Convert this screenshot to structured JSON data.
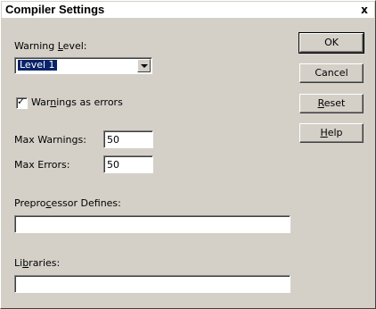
{
  "window": {
    "title": "Compiler Settings",
    "close_glyph": "x"
  },
  "warning_level": {
    "label_pre": "Warning ",
    "label_accel": "L",
    "label_post": "evel:",
    "selected": "Level 1"
  },
  "warnings_as_errors": {
    "checked": true,
    "check_glyph": "✓",
    "label_pre": "War",
    "label_accel": "n",
    "label_post": "ings as errors"
  },
  "max_warnings": {
    "label": "Max Warnings:",
    "value": "50"
  },
  "max_errors": {
    "label": "Max Errors:",
    "value": "50"
  },
  "preprocessor_defines": {
    "label_pre": "Prepro",
    "label_accel": "c",
    "label_post": "essor Defines:",
    "value": ""
  },
  "libraries": {
    "label_pre": "Li",
    "label_accel": "b",
    "label_post": "raries:",
    "value": ""
  },
  "buttons": {
    "ok": "OK",
    "cancel": "Cancel",
    "reset_accel": "R",
    "reset_rest": "eset",
    "help_accel": "H",
    "help_rest": "elp"
  },
  "colors": {
    "dialog_face": "#d4d0c8",
    "selection": "#0a246a"
  }
}
